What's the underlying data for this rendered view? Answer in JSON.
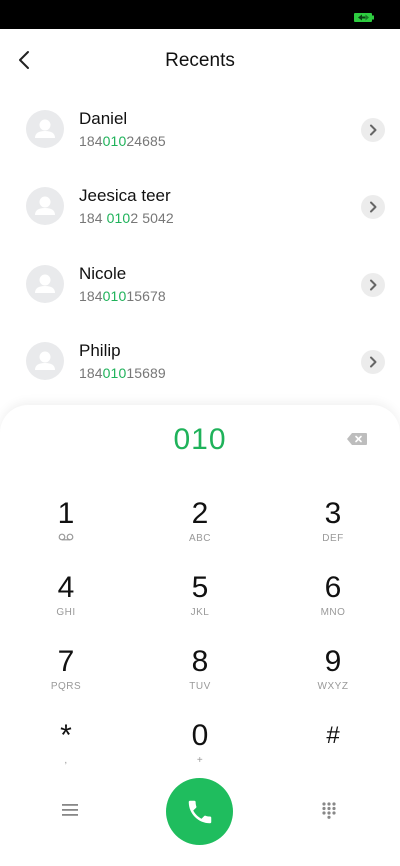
{
  "header": {
    "title": "Recents",
    "back_icon": "chevron-left-icon"
  },
  "recents": [
    {
      "name": "Daniel",
      "number_pre": "184",
      "number_match": "010",
      "number_post": "24685"
    },
    {
      "name": "Jeesica teer",
      "number_pre": "184 ",
      "number_match": "010",
      "number_post": "2 5042"
    },
    {
      "name": "Nicole",
      "number_pre": "184",
      "number_match": "010",
      "number_post": "15678"
    },
    {
      "name": "Philip",
      "number_pre": "184",
      "number_match": "010",
      "number_post": "15689"
    }
  ],
  "dialpad": {
    "input": "010",
    "keys": [
      {
        "digit": "1",
        "letters": ""
      },
      {
        "digit": "2",
        "letters": "ABC"
      },
      {
        "digit": "3",
        "letters": "DEF"
      },
      {
        "digit": "4",
        "letters": "GHI"
      },
      {
        "digit": "5",
        "letters": "JKL"
      },
      {
        "digit": "6",
        "letters": "MNO"
      },
      {
        "digit": "7",
        "letters": "PQRS"
      },
      {
        "digit": "8",
        "letters": "TUV"
      },
      {
        "digit": "9",
        "letters": "WXYZ"
      },
      {
        "digit": "*",
        "letters": ","
      },
      {
        "digit": "0",
        "letters": "+"
      },
      {
        "digit": "#",
        "letters": ""
      }
    ]
  },
  "colors": {
    "accent": "#1fb25a",
    "call_button": "#1fbd5e",
    "status_bar": "#000000",
    "battery": "#2ecc40"
  },
  "icons": {
    "battery": "battery-charging-icon",
    "contact": "person-icon",
    "detail": "chevron-right-icon",
    "backspace": "backspace-icon",
    "voicemail": "voicemail-icon",
    "menu": "menu-icon",
    "call": "phone-icon",
    "keypad": "keypad-icon"
  }
}
